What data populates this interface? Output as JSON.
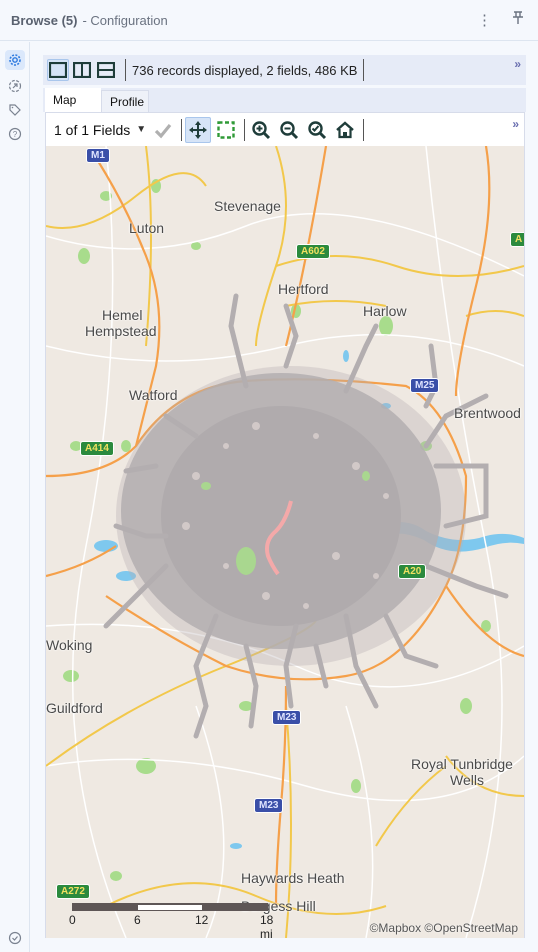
{
  "window": {
    "title": "Browse (5)",
    "subtitle": "- Configuration",
    "menu_icon": "more-vertical-icon",
    "pin_icon": "pin-icon"
  },
  "sidebar": {
    "items": [
      {
        "icon": "gear-icon",
        "active": true
      },
      {
        "icon": "arrow-in-circle-icon",
        "active": false
      },
      {
        "icon": "tag-icon",
        "active": false
      },
      {
        "icon": "help-icon",
        "active": false
      }
    ],
    "bottom_icon": "check-circle-icon"
  },
  "browse": {
    "layout_buttons": [
      "single-pane-icon",
      "split-vertical-icon",
      "split-horizontal-icon"
    ],
    "records_text": "736 records displayed, 2 fields, 486 KB",
    "overflow": "»"
  },
  "tabs": [
    {
      "label": "Map",
      "active": true
    },
    {
      "label": "Profile",
      "active": false
    }
  ],
  "map_toolbar": {
    "fields_select": "1 of 1 Fields",
    "tools": [
      "check-icon",
      "pan-icon",
      "select-rectangle-icon",
      "zoom-in-icon",
      "zoom-out-icon",
      "zoom-to-selection-icon",
      "home-icon"
    ],
    "overflow": "»"
  },
  "map": {
    "places": [
      {
        "name": "Stevenage"
      },
      {
        "name": "Luton"
      },
      {
        "name": "Hertford"
      },
      {
        "name": "Harlow"
      },
      {
        "name": "Hemel"
      },
      {
        "name": "Hempstead"
      },
      {
        "name": "Watford"
      },
      {
        "name": "Brentwood"
      },
      {
        "name": "Woking"
      },
      {
        "name": "Guildford"
      },
      {
        "name": "Royal Tunbridge"
      },
      {
        "name": "Wells"
      },
      {
        "name": "Haywards Heath"
      },
      {
        "name": "Burgess Hill"
      }
    ],
    "road_shields": [
      {
        "label": "M1",
        "type": "motorway"
      },
      {
        "label": "A602",
        "type": "primary"
      },
      {
        "label": "M25",
        "type": "motorway"
      },
      {
        "label": "A414",
        "type": "primary"
      },
      {
        "label": "A20",
        "type": "primary"
      },
      {
        "label": "M23",
        "type": "motorway"
      },
      {
        "label": "M23",
        "type": "motorway"
      },
      {
        "label": "A272",
        "type": "primary"
      },
      {
        "label": "A",
        "type": "primary"
      }
    ],
    "scale": {
      "ticks": [
        "0",
        "6",
        "12",
        "18 mi"
      ]
    },
    "attribution": "©Mapbox ©OpenStreetMap",
    "colors": {
      "land": "#efe9e2",
      "water": "#7ec8ee",
      "park": "#a8dc8c",
      "motorway": "#f5a04a",
      "primary": "#f2c84b",
      "overlay": "#b3aeb0",
      "highlight": "#f4a9a9"
    }
  }
}
